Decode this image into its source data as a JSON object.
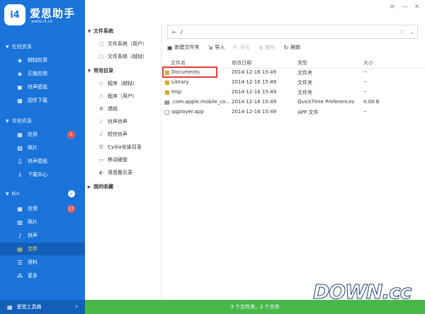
{
  "sidebar": {
    "logo": "i4",
    "brand": "爱思助手",
    "brand_sub": "www.i4.cn",
    "online_title": "在线资源",
    "online": [
      {
        "label": "越狱应用",
        "icon": "cube-icon"
      },
      {
        "label": "正版应用",
        "icon": "cube-icon"
      },
      {
        "label": "铃声壁纸",
        "icon": "image-icon"
      },
      {
        "label": "固件下载",
        "icon": "chip-icon"
      }
    ],
    "local_title": "本地资源",
    "local": [
      {
        "label": "应用",
        "icon": "grid-icon",
        "badge": "1"
      },
      {
        "label": "照片",
        "icon": "photo-icon"
      },
      {
        "label": "铃声壁纸",
        "icon": "music-icon"
      },
      {
        "label": "下载中心",
        "icon": "download-icon"
      }
    ],
    "device_title": "Bin",
    "device": [
      {
        "label": "应用",
        "icon": "grid-icon",
        "badge": "17"
      },
      {
        "label": "照片",
        "icon": "photo-icon"
      },
      {
        "label": "铃声",
        "icon": "bell-icon"
      },
      {
        "label": "文件",
        "icon": "file-icon",
        "active": true
      },
      {
        "label": "资料",
        "icon": "list-icon"
      },
      {
        "label": "更多",
        "icon": "more-icon"
      }
    ],
    "toolbox": "爱思工具箱"
  },
  "tree": {
    "filesystem": "文件系统",
    "fs_user": "文件系统（用户）",
    "fs_jb": "文件系统（越狱）",
    "common": "常用目录",
    "items": [
      "程序（越狱）",
      "程序（用户）",
      "墙纸",
      "铃声铃声",
      "短信铃声",
      "Cydia安装目录",
      "移动硬盘",
      "语音备忘录"
    ],
    "favorites": "我的收藏"
  },
  "address": {
    "path": "/"
  },
  "toolbar": {
    "newfolder": "新建文件夹",
    "import": "导入",
    "export": "导出",
    "delete": "删除",
    "refresh": "刷新"
  },
  "table": {
    "columns": [
      "文件名",
      "修改日期",
      "类型",
      "大小"
    ],
    "rows": [
      {
        "name": "Documents",
        "date": "2014-12-16 15:49",
        "type": "文件夹",
        "size": "--",
        "icon": "folder-icon"
      },
      {
        "name": "Library",
        "date": "2014-12-16 15:49",
        "type": "文件夹",
        "size": "--",
        "icon": "folder-icon"
      },
      {
        "name": "tmp",
        "date": "2014-12-16 15:49",
        "type": "文件夹",
        "size": "--",
        "icon": "folder-icon"
      },
      {
        "name": ".com.apple.mobile_co...",
        "date": "2014-12-16 15:49",
        "type": "QuickTime Preferences",
        "size": "0.00 B",
        "icon": "file-icon"
      },
      {
        "name": "qqplayer.app",
        "date": "2014-12-16 15:49",
        "type": "APP 文件",
        "size": "--",
        "icon": "app-icon"
      }
    ]
  },
  "status": "3 个文件夹，2 个文件",
  "watermark": "DOWN.cc"
}
